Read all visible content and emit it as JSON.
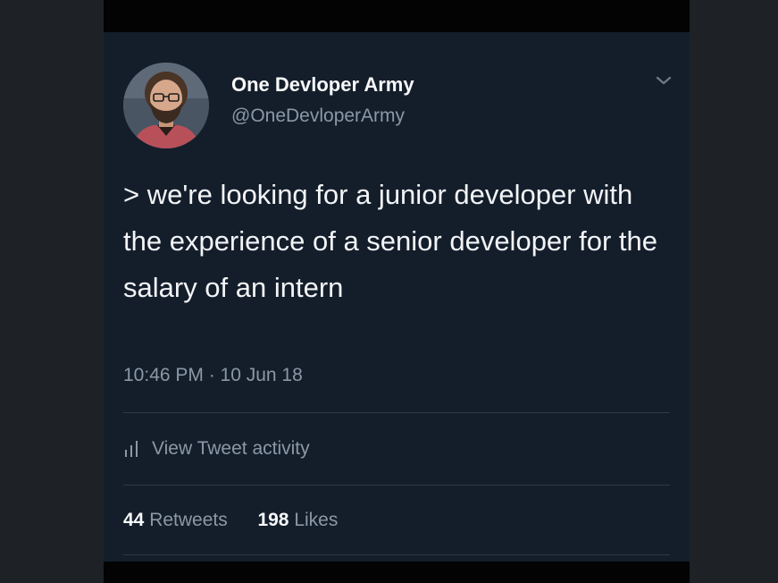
{
  "tweet": {
    "display_name": "One Devloper Army",
    "handle": "@OneDevloperArmy",
    "text": "> we're looking for a junior developer with the experience of a senior developer for the salary of an intern",
    "timestamp": "10:46 PM · 10 Jun 18",
    "activity_label": "View Tweet activity",
    "retweets_count": "44",
    "retweets_label": "Retweets",
    "likes_count": "198",
    "likes_label": "Likes",
    "icons": {
      "menu": "chevron-down-icon",
      "activity": "bar-chart-icon"
    }
  },
  "colors": {
    "tweet_background": "#141e2b",
    "primary_text": "#f2f4f6",
    "secondary_text": "#8b98a5",
    "divider": "#2d3947",
    "outer_background": "#1e2226"
  }
}
